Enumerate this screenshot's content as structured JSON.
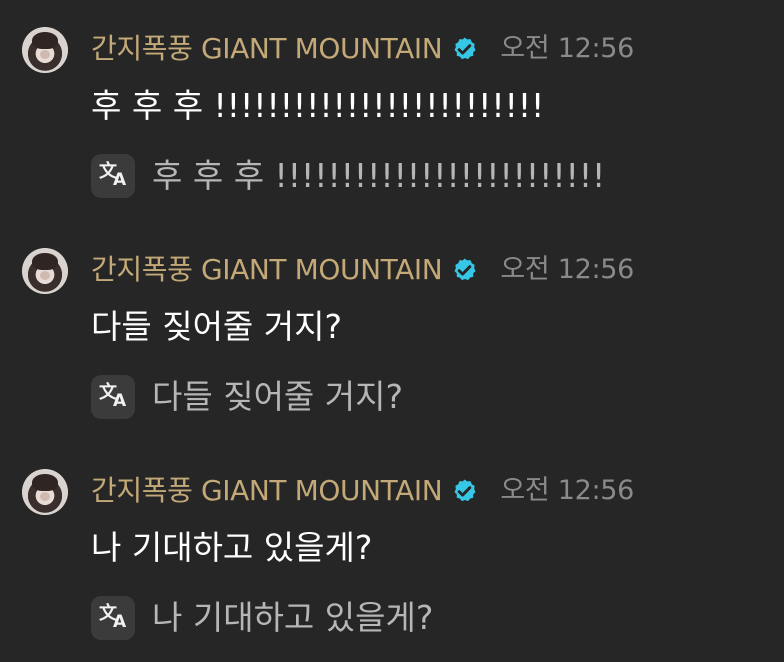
{
  "messages": [
    {
      "author": "간지폭풍 GIANT MOUNTAIN",
      "timestamp": "오전 12:56",
      "text": "후 후 후 !!!!!!!!!!!!!!!!!!!!!!!!!",
      "translation": "후 후 후 !!!!!!!!!!!!!!!!!!!!!!!!!",
      "avatar_icon": "user-avatar",
      "verified_icon": "verified-check-icon",
      "translate_icon": "translate-icon"
    },
    {
      "author": "간지폭풍 GIANT MOUNTAIN",
      "timestamp": "오전 12:56",
      "text": "다들 짖어줄 거지?",
      "translation": "다들 짖어줄 거지?",
      "avatar_icon": "user-avatar",
      "verified_icon": "verified-check-icon",
      "translate_icon": "translate-icon"
    },
    {
      "author": "간지폭풍 GIANT MOUNTAIN",
      "timestamp": "오전 12:56",
      "text": "나 기대하고 있을게?",
      "translation": "나 기대하고 있을게?",
      "avatar_icon": "user-avatar",
      "verified_icon": "verified-check-icon",
      "translate_icon": "translate-icon"
    }
  ],
  "colors": {
    "background": "#262626",
    "author": "#c3a977",
    "timestamp": "#8a8a8a",
    "message_text": "#ffffff",
    "translation_text": "#b6b6b6",
    "verified_badge": "#35c7e5",
    "translate_button": "#3b3b3b"
  }
}
